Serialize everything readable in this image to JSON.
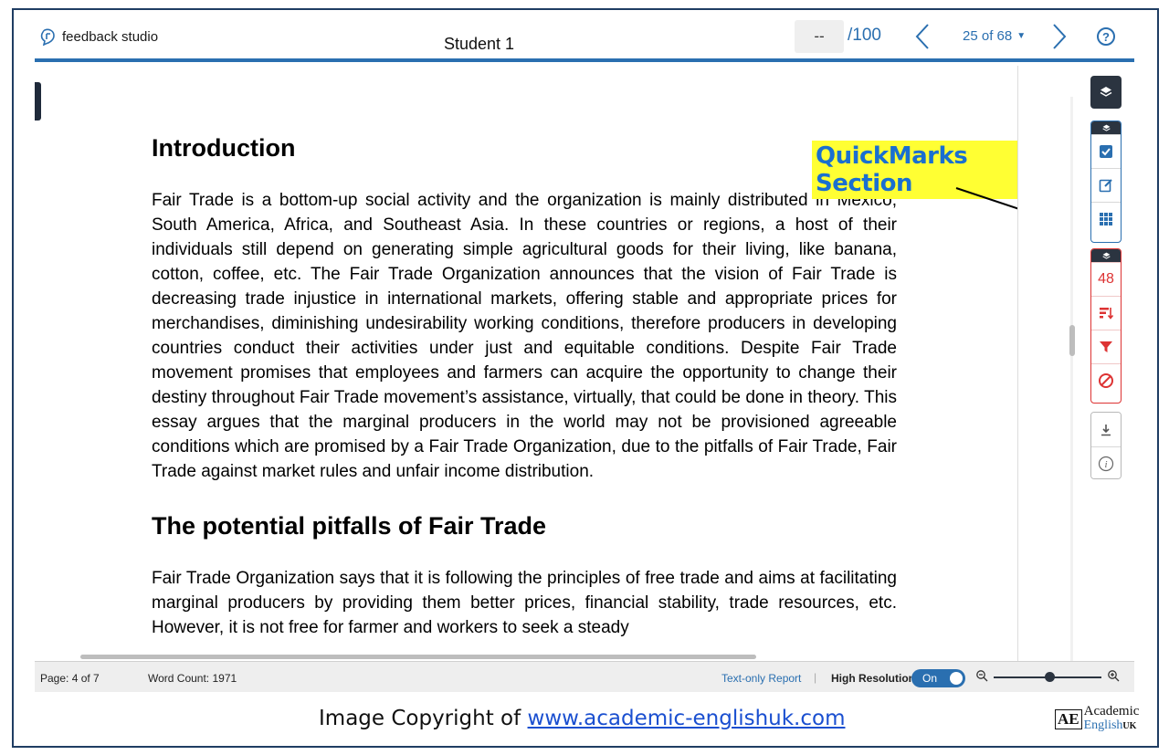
{
  "header": {
    "brand": "feedback studio",
    "student": "Student 1",
    "score_value": "--",
    "score_max": "/100",
    "pager": "25 of 68",
    "help": "?"
  },
  "document": {
    "heading1": "Introduction",
    "paragraph1": "Fair Trade is a bottom-up social activity and the organization is mainly distributed in Mexico, South America, Africa, and Southeast Asia. In these countries or regions, a host of their individuals still depend on generating simple agricultural goods for their living, like banana, cotton, coffee, etc. The Fair Trade Organization announces that the vision of Fair Trade is decreasing trade injustice in international markets, offering stable and appropriate prices for merchandises, diminishing undesirability working conditions, therefore producers in developing countries conduct their activities under just and equitable conditions. Despite Fair Trade movement promises that employees and farmers can acquire the opportunity to change their destiny throughout Fair Trade movement’s assistance, virtually, that could be done in theory. This essay argues that the marginal producers in the world may not be provisioned agreeable conditions which are promised by a Fair Trade Organization, due to the pitfalls of Fair Trade, Fair Trade against market rules and unfair income distribution.",
    "heading2": "The potential pitfalls of Fair Trade",
    "paragraph2": "Fair Trade Organization says that it is following the principles of free trade and aims at facilitating marginal producers by providing them better prices, financial stability, trade resources, etc. However, it is not free for farmer and workers to seek a steady"
  },
  "annotation": {
    "label": "QuickMarks Section",
    "label_bg": "#ffff33",
    "label_color": "#1a6fd0"
  },
  "sidebar": {
    "grading_count": "48",
    "colors": {
      "dark": "#2b3440",
      "blue": "#2a6fb0",
      "red": "#d33333"
    }
  },
  "status": {
    "page": "Page: 4 of 7",
    "word_count": "Word Count: 1971",
    "text_only": "Text-only Report",
    "high_res_label": "High Resolution",
    "toggle": "On"
  },
  "footer": {
    "copyright_prefix": "Image Copyright of ",
    "copyright_link": "www.academic-englishuk.com",
    "logo_box": "AE",
    "logo_line1": "Academic",
    "logo_line2": "English",
    "logo_suffix": "UK"
  }
}
